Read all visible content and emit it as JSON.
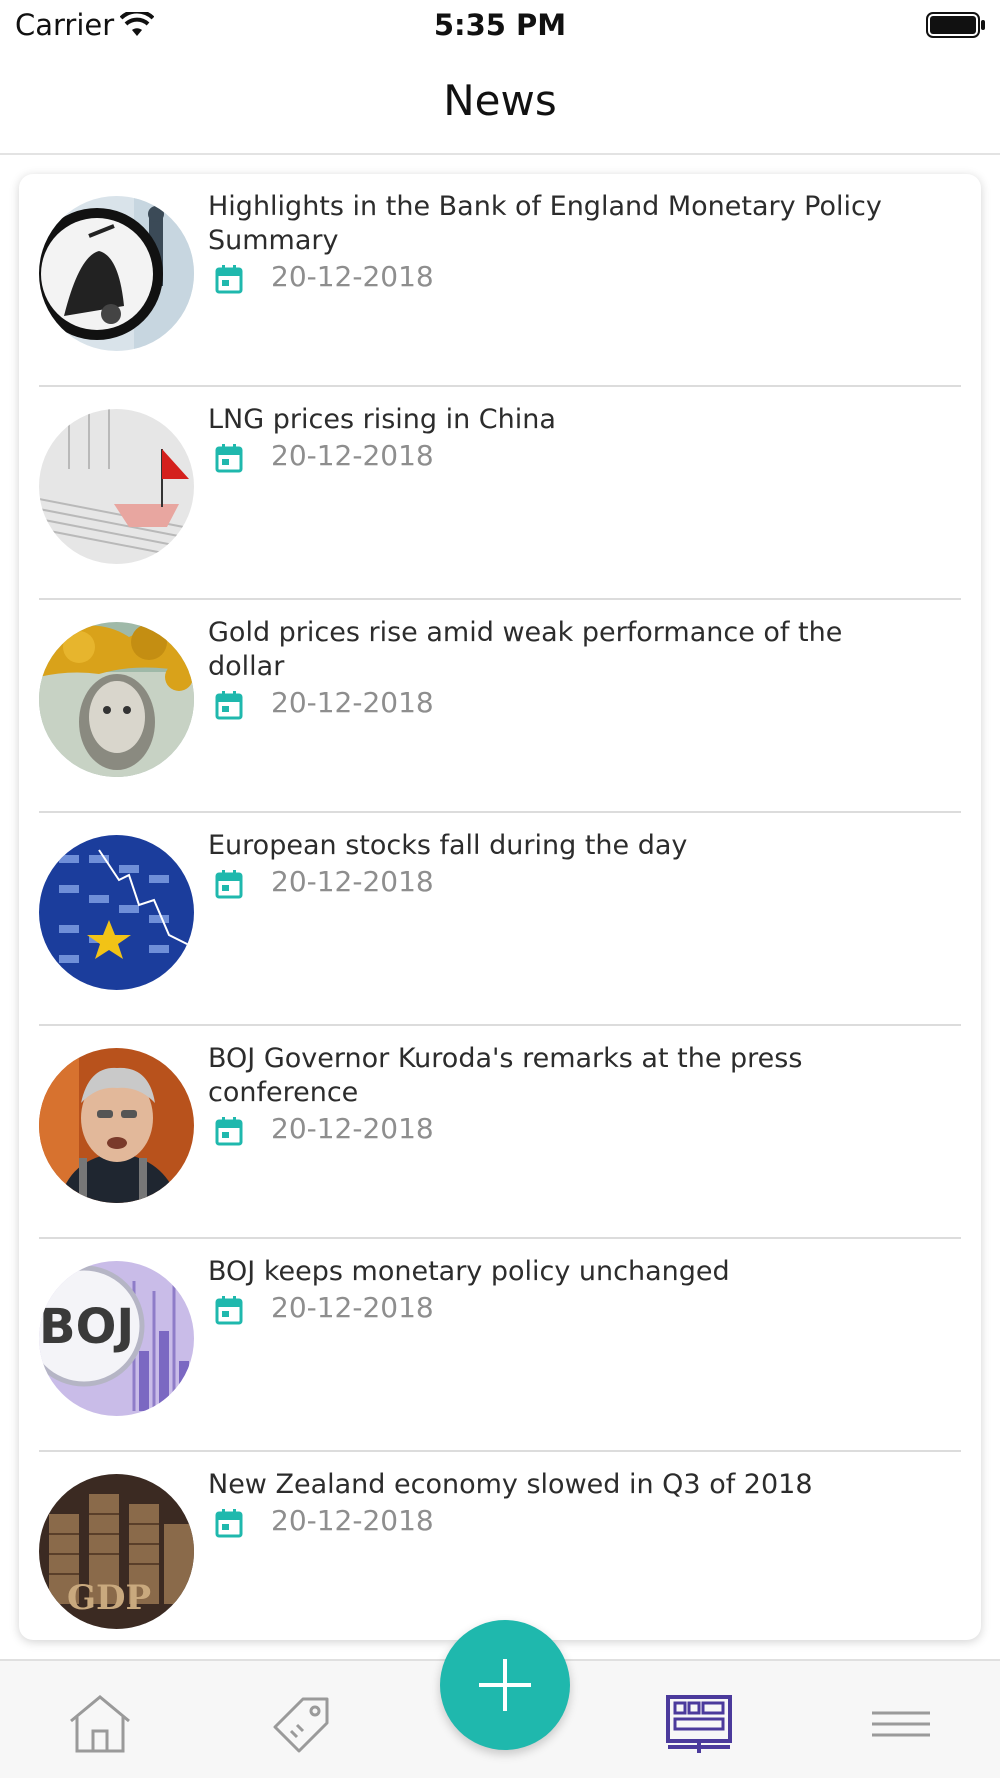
{
  "status_bar": {
    "carrier": "Carrier",
    "time": "5:35 PM"
  },
  "nav": {
    "title": "News"
  },
  "colors": {
    "accent": "#1fb8ad",
    "active_tab": "#4b3a9c",
    "inactive_tab": "#9a9a9a",
    "date": "#8e8e8e"
  },
  "news": [
    {
      "title": "Highlights in the Bank of England Monetary Policy Summary",
      "date": "20-12-2018",
      "icon": "calendar-icon"
    },
    {
      "title": "LNG prices rising in China",
      "date": "20-12-2018",
      "icon": "calendar-icon"
    },
    {
      "title": "Gold prices rise amid weak performance of the dollar",
      "date": "20-12-2018",
      "icon": "calendar-icon"
    },
    {
      "title": "European stocks fall during the day",
      "date": "20-12-2018",
      "icon": "calendar-icon"
    },
    {
      "title": "BOJ Governor Kuroda's remarks at the press conference",
      "date": "20-12-2018",
      "icon": "calendar-icon"
    },
    {
      "title": "BOJ keeps monetary policy unchanged",
      "date": "20-12-2018",
      "icon": "calendar-icon",
      "thumb_text": "BOJ"
    },
    {
      "title": "New Zealand economy slowed in Q3 of 2018",
      "date": "20-12-2018",
      "icon": "calendar-icon",
      "thumb_text": "GDP"
    }
  ],
  "tab_bar": {
    "tabs": [
      {
        "name": "home",
        "icon": "home-icon",
        "active": false
      },
      {
        "name": "tags",
        "icon": "tag-icon",
        "active": false
      },
      {
        "name": "add",
        "icon": "plus-icon",
        "active": false
      },
      {
        "name": "news",
        "icon": "news-icon",
        "active": true
      },
      {
        "name": "menu",
        "icon": "menu-icon",
        "active": false
      }
    ]
  }
}
